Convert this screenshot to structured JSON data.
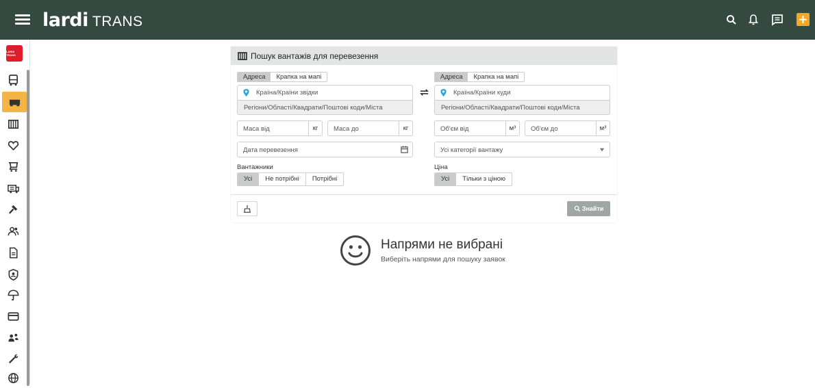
{
  "header": {
    "logo_main": "lardi",
    "logo_sub": "TRANS"
  },
  "sidebar": {
    "brand": "LARDI TRANS",
    "items": [
      {
        "icon": "bus-icon"
      },
      {
        "icon": "truck-icon",
        "active": true
      },
      {
        "icon": "cargo-icon"
      },
      {
        "icon": "heart-icon"
      },
      {
        "icon": "cart-icon"
      },
      {
        "icon": "fleet-icon"
      },
      {
        "icon": "auction-icon"
      },
      {
        "icon": "users-icon"
      },
      {
        "icon": "document-icon"
      },
      {
        "icon": "shield-user-icon"
      },
      {
        "icon": "umbrella-icon"
      },
      {
        "icon": "card-icon"
      },
      {
        "icon": "partners-icon"
      },
      {
        "icon": "tools-icon"
      },
      {
        "icon": "globe-icon"
      }
    ]
  },
  "form": {
    "title": "Пошук вантажів для перевезення",
    "from_tabs": [
      "Адреса",
      "Крапка на мапі"
    ],
    "to_tabs": [
      "Адреса",
      "Крапка на мапі"
    ],
    "from_country_placeholder": "Країна/Країни звідки",
    "to_country_placeholder": "Країна/Країни куди",
    "region_placeholder": "Регіони/Області/Квадрати/Поштові коди/Міста",
    "mass_from": "Маса від",
    "mass_to": "Маса до",
    "mass_unit": "кг",
    "volume_from": "Об'єм від",
    "volume_to": "Об'єм до",
    "volume_unit": "м³",
    "date_placeholder": "Дата перевезення",
    "category_placeholder": "Усі категорії вантажу",
    "loaders_label": "Вантажники",
    "loaders_options": [
      "Усі",
      "Не потрібні",
      "Потрібні"
    ],
    "price_label": "Ціна",
    "price_options": [
      "Усі",
      "Тільки з ціною"
    ],
    "search_button": "Знайти"
  },
  "empty_state": {
    "title": "Напрями не вибрані",
    "subtitle": "Виберіть напрями для пошуку заявок"
  },
  "colors": {
    "topbar": "#34493f",
    "accent": "#f4b545",
    "plus": "#f5a623",
    "pin": "#29a8e0"
  }
}
